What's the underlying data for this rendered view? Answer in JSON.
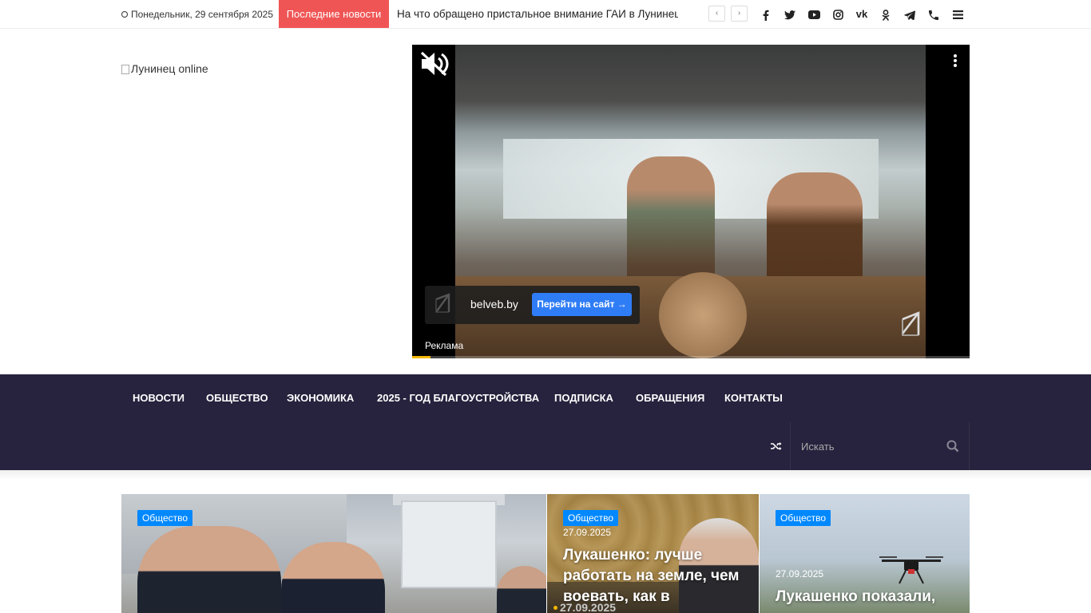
{
  "topbar": {
    "date": "Понедельник, 29 сентября 2025",
    "latest_label": "Последние новости",
    "ticker_text": "На что обращено пристальное внимание ГАИ в Лунинецком районе",
    "prev_icon": "chevron-left-icon",
    "next_icon": "chevron-right-icon",
    "social": [
      "facebook-icon",
      "twitter-icon",
      "youtube-icon",
      "instagram-icon",
      "vk-icon",
      "odnoklassniki-icon",
      "telegram-icon",
      "phone-icon",
      "menu-icon"
    ],
    "vk_glyph": "vk"
  },
  "logo": {
    "alt_text": "Лунинец online"
  },
  "ad": {
    "domain": "belveb.by",
    "cta_label": "Перейти на сайт →",
    "label": "Реклама",
    "progress": 0.033,
    "mute_icon": "volume-mute-icon",
    "more_icon": "kebab-menu-icon"
  },
  "nav": {
    "items": [
      "Новости",
      "Общество",
      "Экономика",
      "2025 - Год благоустройства",
      "Подписка",
      "Обращения",
      "Контакты"
    ],
    "shuffle_icon": "shuffle-icon",
    "search_placeholder": "Искать",
    "search_icon": "search-icon"
  },
  "cards": [
    {
      "category": "Общество"
    },
    {
      "category": "Общество",
      "date": "27.09.2025",
      "title": "Лукашенко: лучше работать на земле, чем воевать, как в",
      "date2": "27.09.2025"
    },
    {
      "category": "Общество",
      "date": "27.09.2025",
      "title": "Лукашенко показали,"
    }
  ],
  "colors": {
    "latest_badge": "#f05555",
    "nav_bg": "#27223d",
    "category_badge": "#0088ff",
    "cta": "#2f7df6",
    "progress": "#f5b800"
  }
}
